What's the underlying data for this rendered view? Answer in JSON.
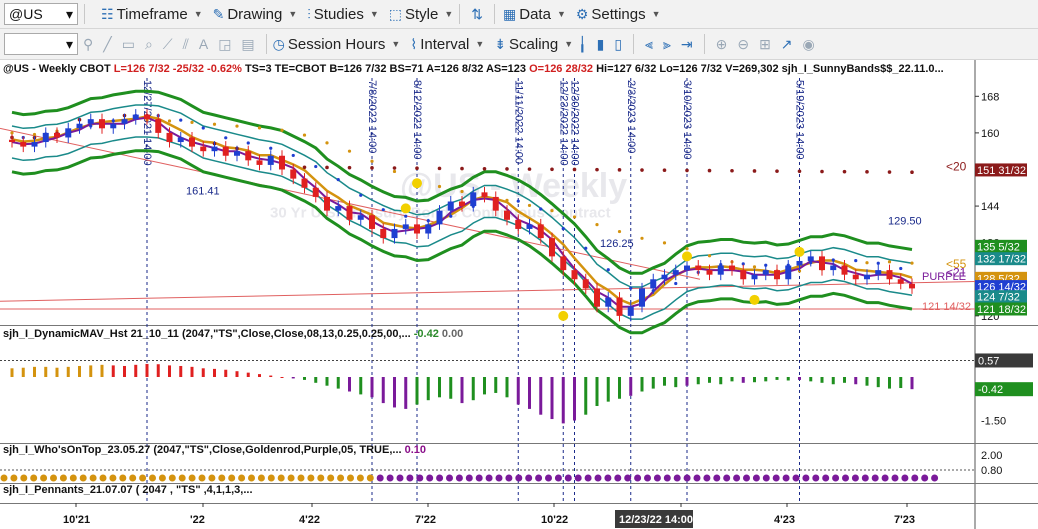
{
  "toolbar1": {
    "symbol": "@US",
    "menus": [
      {
        "label": "Timeframe",
        "icon": "calendar-icon"
      },
      {
        "label": "Drawing",
        "icon": "pencil-icon"
      },
      {
        "label": "Studies",
        "icon": "studies-icon"
      },
      {
        "label": "Style",
        "icon": "style-icon"
      },
      {
        "label": "Data",
        "icon": "table-icon"
      },
      {
        "label": "Settings",
        "icon": "gear-icon"
      }
    ]
  },
  "toolbar2": {
    "symbol_blank": "",
    "session_hours": "Session Hours",
    "interval": "Interval",
    "scaling": "Scaling"
  },
  "title_bar": {
    "prefix": "@US - Weekly  CBOT  ",
    "L": "L=126 7/32  -25/32  -0.62%",
    "rest": "  TS=3  TE=CBOT  B=126 7/32  BS=71  A=126 8/32  AS=123  ",
    "O": "O=126 28/32",
    "tail": "  Hi=127 6/32  Lo=126 7/32  V=269,302  sjh_I_SunnyBands$$_22.11.0..."
  },
  "watermark": {
    "line1": "@US - Weekly",
    "line2": "30 Yr U.S. Treasury Bonds Continuous Contract"
  },
  "panels": {
    "mav_title": "sjh_I_DynamicMAV_Hst 21_10_11 (2047,\"TS\",Close,Close,08,13,0.25,0.25,00,...",
    "mav_val1": "-0.42",
    "mav_val2": "0.00",
    "who_title": "sjh_I_Who'sOnTop_23.05.27 (2047,\"TS\",Close,Goldenrod,Purple,05,  TRUE,...",
    "who_val": "0.10",
    "pen_title": "sjh_I_Pennants_21.07.07 ( 2047 , \"TS\" ,4,1,1,3,..."
  },
  "colors": {
    "up": "#1f3fd1",
    "down": "#e02020",
    "band_outer": "#1f8f1f",
    "band_inner": "#1a8a8a",
    "gold": "#d4930f",
    "purple": "#7a1a9a",
    "maroon": "#8b1a1a",
    "teal": "#1a8a8a"
  },
  "chart_data": {
    "type": "candlestick",
    "y_ticks": [
      168,
      160,
      152,
      144,
      136,
      128,
      120
    ],
    "y_tick_labels_shown": [
      "168",
      "160",
      "144",
      "136",
      "120"
    ],
    "ylim": [
      118,
      172
    ],
    "x_tick_labels": [
      "10'21",
      "'22",
      "4'22",
      "7'22",
      "10'22",
      "1'23",
      "4'23",
      "7'23"
    ],
    "x_highlight": "12/23/22 14:00",
    "vertical_line_labels": [
      "12/27/2021 14:00",
      "7/8/2022 14:00",
      "8/12/2022 14:00",
      "11/11/2022 14:00",
      "12/23/2022 14:00",
      "12/30/2022 14:00",
      "2/3/2023 14:00",
      "3/10/2023 14:00",
      "5/19/2023 14:00"
    ],
    "annotations": [
      "161.41",
      "126.25",
      "129.50",
      "PURPLE"
    ],
    "price_badges": [
      {
        "label": "151 31/32",
        "color": "#8b1a1a",
        "text_color": "#ffffff"
      },
      {
        "label": "135 5/32",
        "color": "#1f8f1f",
        "text_color": "#ffffff"
      },
      {
        "label": "132 17/32",
        "color": "#1a8a8a",
        "text_color": "#ffffff"
      },
      {
        "label": "128 5/32",
        "color": "#d4930f",
        "text_color": "#ffffff"
      },
      {
        "label": "126 14/32",
        "color": "#1f3fd1",
        "text_color": "#ffffff"
      },
      {
        "label": "124 7/32",
        "color": "#1a8a8a",
        "text_color": "#ffffff"
      },
      {
        "label": "121 18/32",
        "color": "#1f8f1f",
        "text_color": "#ffffff"
      }
    ],
    "side_labels": [
      {
        "text": "<20",
        "color": "#8b1a1a"
      },
      {
        "text": "<55",
        "color": "#d4930f"
      },
      {
        "text": "<21",
        "color": "#7a1a9a"
      },
      {
        "text": "121 14/32",
        "color": "#e06060"
      }
    ],
    "close_series": [
      158,
      157,
      158,
      160,
      159,
      161,
      162,
      163,
      161,
      162,
      163,
      164,
      163,
      160,
      158,
      159,
      157,
      156,
      157,
      155,
      156,
      154,
      153,
      155,
      152,
      150,
      148,
      146,
      143,
      144,
      141,
      142,
      139,
      137,
      139,
      140,
      138,
      140,
      143,
      145,
      144,
      147,
      146,
      143,
      141,
      139,
      140,
      137,
      133,
      130,
      128,
      126,
      122,
      124,
      120,
      122,
      126,
      128,
      129,
      130,
      131,
      130,
      129,
      131,
      130,
      128,
      129,
      130,
      128,
      131,
      132,
      133,
      130,
      131,
      129,
      128,
      129,
      130,
      128,
      127,
      126
    ],
    "histogram": {
      "ticks": [
        "0.57",
        "-0.42",
        "-1.50"
      ],
      "ylim": [
        -2.0,
        1.0
      ],
      "values": [
        0.3,
        0.32,
        0.35,
        0.35,
        0.32,
        0.35,
        0.38,
        0.4,
        0.42,
        0.4,
        0.38,
        0.42,
        0.45,
        0.44,
        0.4,
        0.38,
        0.35,
        0.3,
        0.28,
        0.25,
        0.2,
        0.15,
        0.1,
        0.05,
        0.0,
        -0.05,
        -0.1,
        -0.2,
        -0.3,
        -0.4,
        -0.5,
        -0.6,
        -0.7,
        -0.9,
        -1.05,
        -1.1,
        -0.95,
        -0.8,
        -0.7,
        -0.75,
        -0.9,
        -0.8,
        -0.6,
        -0.55,
        -0.7,
        -0.95,
        -1.1,
        -1.3,
        -1.45,
        -1.6,
        -1.5,
        -1.3,
        -1.0,
        -0.85,
        -0.75,
        -0.65,
        -0.5,
        -0.4,
        -0.3,
        -0.35,
        -0.3,
        -0.25,
        -0.2,
        -0.25,
        -0.15,
        -0.2,
        -0.18,
        -0.15,
        -0.1,
        -0.12,
        -0.1,
        -0.15,
        -0.2,
        -0.25,
        -0.2,
        -0.25,
        -0.3,
        -0.35,
        -0.4,
        -0.38,
        -0.42
      ]
    },
    "who_ticks": [
      "2.00",
      "0.80"
    ]
  }
}
